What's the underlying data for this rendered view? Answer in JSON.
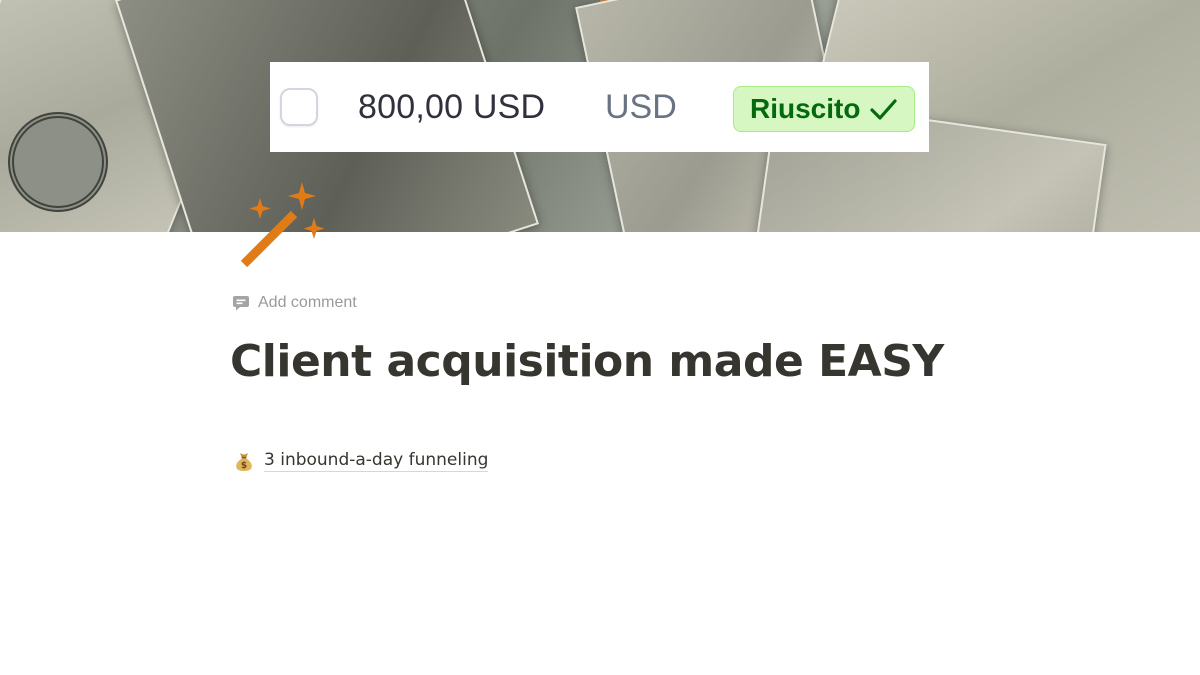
{
  "cover": {
    "image": "money-banknotes-photo"
  },
  "payment": {
    "amount": "800,00 USD",
    "currency": "USD",
    "status": "Riuscito",
    "status_icon": "check-icon",
    "status_bg_color": "#d7f7c2",
    "status_text_color": "#05690d"
  },
  "page": {
    "icon": "magic-wand-icon",
    "icon_color": "#e07b16",
    "add_comment_icon": "comment-icon",
    "add_comment_label": "Add comment",
    "title": "Client acquisition made EASY",
    "links": [
      {
        "icon": "money-bag-icon",
        "label": "3 inbound-a-day funneling"
      }
    ]
  }
}
